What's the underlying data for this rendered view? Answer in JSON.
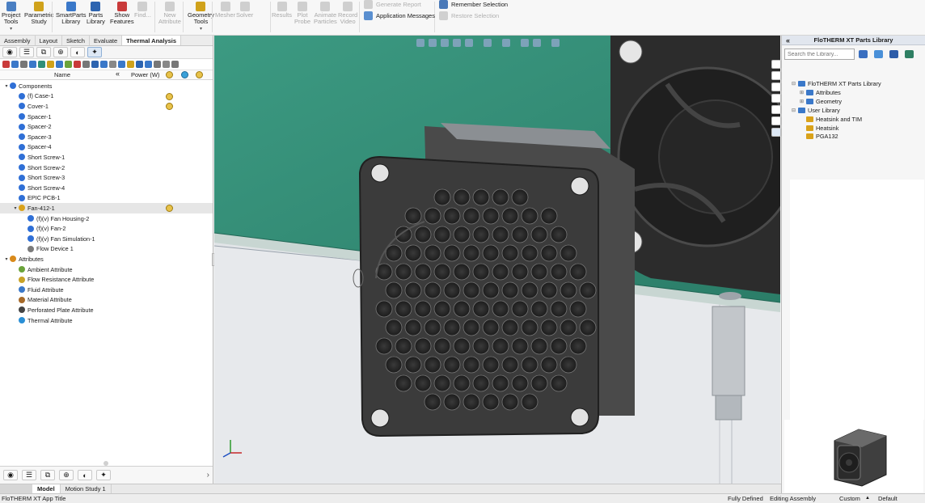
{
  "ribbon": {
    "buttons": [
      {
        "label": "Project\nTools",
        "icon": "project-tools-icon"
      },
      {
        "label": "Parametric\nStudy",
        "icon": "parametric-study-icon"
      },
      {
        "label": "SmartParts\nLibrary",
        "icon": "smartparts-icon"
      },
      {
        "label": "Parts\nLibrary",
        "icon": "parts-library-icon"
      },
      {
        "label": "Show\nFeatures",
        "icon": "show-features-icon"
      },
      {
        "label": "Find...",
        "icon": "find-icon",
        "disabled": true
      },
      {
        "label": "New\nAttribute",
        "icon": "new-attribute-icon",
        "disabled": true
      },
      {
        "label": "Geometry\nTools",
        "icon": "geometry-tools-icon"
      },
      {
        "label": "Mesher",
        "icon": "mesher-icon",
        "disabled": true
      },
      {
        "label": "Solver",
        "icon": "solver-icon",
        "disabled": true
      },
      {
        "label": "Results",
        "icon": "results-icon",
        "disabled": true
      },
      {
        "label": "Plot\nProbe",
        "icon": "plot-probe-icon",
        "disabled": true
      },
      {
        "label": "Animate\nParticles",
        "icon": "animate-particles-icon",
        "disabled": true
      },
      {
        "label": "Record\nVideo",
        "icon": "record-video-icon",
        "disabled": true
      }
    ],
    "generate_report": "Generate Report",
    "application_messages": "Application Messages",
    "remember_selection": "Remember Selection",
    "restore_selection": "Restore Selection"
  },
  "tabs": [
    "Assembly",
    "Layout",
    "Sketch",
    "Evaluate",
    "Thermal Analysis"
  ],
  "active_tab": "Thermal Analysis",
  "tree_header": {
    "name": "Name",
    "collapse": "«",
    "power": "Power (W)"
  },
  "tree": [
    {
      "label": "Components",
      "level": 0,
      "expand": "▾",
      "icon": "components-icon",
      "color": "#2f6fd6"
    },
    {
      "label": "(f) Case-1",
      "level": 1,
      "icon": "part-icon",
      "color": "#2f6fd6",
      "power": true
    },
    {
      "label": "Cover-1",
      "level": 1,
      "icon": "part-icon",
      "color": "#2f6fd6",
      "power": true
    },
    {
      "label": "Spacer-1",
      "level": 1,
      "icon": "part-icon",
      "color": "#2f6fd6"
    },
    {
      "label": "Spacer-2",
      "level": 1,
      "icon": "part-icon",
      "color": "#2f6fd6"
    },
    {
      "label": "Spacer-3",
      "level": 1,
      "icon": "part-icon",
      "color": "#2f6fd6"
    },
    {
      "label": "Spacer-4",
      "level": 1,
      "icon": "part-icon",
      "color": "#2f6fd6"
    },
    {
      "label": "Short Screw-1",
      "level": 1,
      "icon": "part-icon",
      "color": "#2f6fd6"
    },
    {
      "label": "Short Screw-2",
      "level": 1,
      "icon": "part-icon",
      "color": "#2f6fd6"
    },
    {
      "label": "Short Screw-3",
      "level": 1,
      "icon": "part-icon",
      "color": "#2f6fd6"
    },
    {
      "label": "Short Screw-4",
      "level": 1,
      "icon": "part-icon",
      "color": "#2f6fd6"
    },
    {
      "label": "EPIC PCB-1",
      "level": 1,
      "icon": "part-icon",
      "color": "#2f6fd6"
    },
    {
      "label": "Fan-412-1",
      "level": 1,
      "expand": "▾",
      "icon": "assembly-icon",
      "color": "#d9a21b",
      "power": true,
      "selected": true
    },
    {
      "label": "(f)(v) Fan Housing-2",
      "level": 2,
      "icon": "part-icon",
      "color": "#2f6fd6"
    },
    {
      "label": "(f)(v) Fan-2",
      "level": 2,
      "icon": "part-icon",
      "color": "#2f6fd6"
    },
    {
      "label": "(f)(v) Fan Simulation-1",
      "level": 2,
      "icon": "part-icon",
      "color": "#2f6fd6"
    },
    {
      "label": "Flow Device 1",
      "level": 2,
      "icon": "flow-device-icon",
      "color": "#7a7a7a"
    },
    {
      "label": "Attributes",
      "level": 0,
      "expand": "▾",
      "icon": "attributes-icon",
      "color": "#d98a1b"
    },
    {
      "label": "Ambient Attribute",
      "level": 1,
      "icon": "ambient-icon",
      "color": "#6aa33a"
    },
    {
      "label": "Flow Resistance Attribute",
      "level": 1,
      "icon": "flow-resistance-icon",
      "color": "#c8a227"
    },
    {
      "label": "Fluid Attribute",
      "level": 1,
      "icon": "fluid-icon",
      "color": "#3a78c9"
    },
    {
      "label": "Material Attribute",
      "level": 1,
      "icon": "material-icon",
      "color": "#a66a2a"
    },
    {
      "label": "Perforated Plate Attribute",
      "level": 1,
      "icon": "perforated-plate-icon",
      "color": "#444444"
    },
    {
      "label": "Thermal Attribute",
      "level": 1,
      "icon": "thermal-icon",
      "color": "#2a8fd6"
    }
  ],
  "library": {
    "title": "FloTHERM XT Parts Library",
    "search_placeholder": "Search the Library...",
    "items": [
      {
        "label": "FloTHERM XT Parts Library",
        "level": 0,
        "expand": "⊟",
        "color": "#3a78c9"
      },
      {
        "label": "Attributes",
        "level": 1,
        "expand": "⊞",
        "color": "#3a78c9"
      },
      {
        "label": "Geometry",
        "level": 1,
        "expand": "⊞",
        "color": "#3a78c9"
      },
      {
        "label": "User Library",
        "level": 0,
        "expand": "⊟",
        "color": "#3a78c9"
      },
      {
        "label": "Heatsink and TIM",
        "level": 1,
        "expand": "",
        "color": "#d9a21b"
      },
      {
        "label": "Heatsink",
        "level": 1,
        "expand": "",
        "color": "#d9a21b"
      },
      {
        "label": "PGA132",
        "level": 1,
        "expand": "",
        "color": "#d9a21b"
      }
    ]
  },
  "bottom_tabs": [
    "Model",
    "Motion Study 1"
  ],
  "active_bottom_tab": "Model",
  "status": {
    "app_title": "FloTHERM XT App Title",
    "fully_defined": "Fully Defined",
    "editing": "Editing Assembly",
    "units": "Custom",
    "units_arrow": "▲",
    "default": "Default"
  },
  "colors": {
    "accent": "#2f6fd6",
    "pcb": "#2f8f78",
    "fan": "#3b3b3b"
  }
}
